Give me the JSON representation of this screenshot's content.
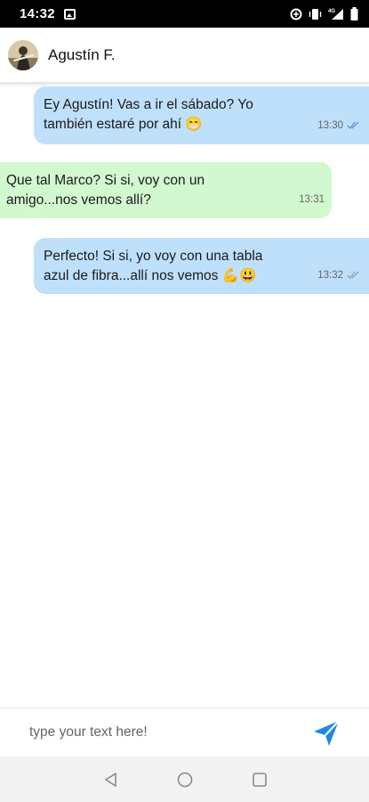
{
  "status_bar": {
    "time": "14:32",
    "icons": [
      "image-icon",
      "data-saver-icon",
      "vibrate-icon",
      "signal-4g-icon",
      "battery-icon"
    ]
  },
  "header": {
    "contact_name": "Agustín F.",
    "avatar_icon": "contact-avatar-photo"
  },
  "messages": [
    {
      "direction": "out",
      "text": "Ey Agustín! Vas a ir el sábado? Yo también estaré por ahí 😁",
      "time": "13:30",
      "status_icon": "double-check-icon"
    },
    {
      "direction": "in",
      "text": "Que tal Marco? Si si, voy con un amigo...nos vemos allí?",
      "time": "13:31"
    },
    {
      "direction": "out",
      "text": "Perfecto! Si si, yo voy con una tabla azul de fibra...allí nos vemos 💪😃",
      "time": "13:32",
      "status_icon": "double-check-icon"
    }
  ],
  "composer": {
    "placeholder": "type your text here!",
    "value": "",
    "send_icon": "send-icon"
  },
  "nav_bar": {
    "icons": [
      "back-icon",
      "home-icon",
      "recents-icon"
    ]
  },
  "colors": {
    "outgoing_bubble": "#bfe0fb",
    "incoming_bubble": "#d2f8cf",
    "send_accent": "#1e88e5",
    "read_check": "#5b8fd6"
  }
}
